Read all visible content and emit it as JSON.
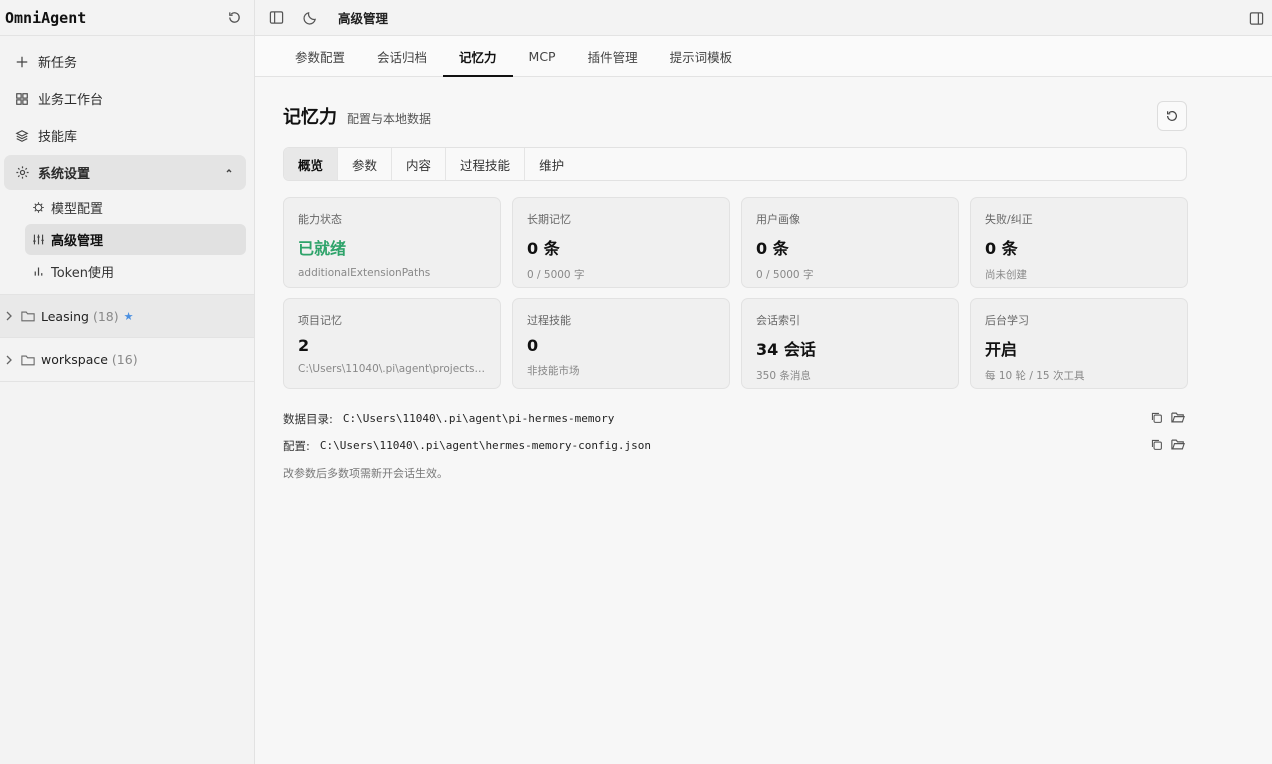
{
  "app": {
    "brand": "OmniAgent"
  },
  "sidebar": {
    "nav": [
      {
        "label": "新任务",
        "icon": "plus-icon"
      },
      {
        "label": "业务工作台",
        "icon": "grid-icon"
      },
      {
        "label": "技能库",
        "icon": "layers-icon"
      },
      {
        "label": "系统设置",
        "icon": "gear-icon"
      }
    ],
    "settings_children": [
      {
        "label": "模型配置",
        "icon": "chip-icon"
      },
      {
        "label": "高级管理",
        "icon": "sliders-icon"
      },
      {
        "label": "Token使用",
        "icon": "bar-chart-icon"
      }
    ],
    "folders": [
      {
        "name": "Leasing",
        "count": "(18)",
        "star": "★"
      },
      {
        "name": "workspace",
        "count": "(16)"
      }
    ]
  },
  "topbar": {
    "title": "高级管理"
  },
  "tabs": [
    "参数配置",
    "会话归档",
    "记忆力",
    "MCP",
    "插件管理",
    "提示词模板"
  ],
  "page": {
    "title": "记忆力",
    "subtitle": "配置与本地数据",
    "segments": [
      "概览",
      "参数",
      "内容",
      "过程技能",
      "维护"
    ],
    "cards": [
      {
        "label": "能力状态",
        "value": "已就绪",
        "note": "additionalExtensionPaths"
      },
      {
        "label": "长期记忆",
        "value": "0 条",
        "note": "0 / 5000 字"
      },
      {
        "label": "用户画像",
        "value": "0 条",
        "note": "0 / 5000 字"
      },
      {
        "label": "失败/纠正",
        "value": "0 条",
        "note": "尚未创建"
      },
      {
        "label": "项目记忆",
        "value": "2",
        "note": "C:\\Users\\11040\\.pi\\agent\\projects-m..."
      },
      {
        "label": "过程技能",
        "value": "0",
        "note": "非技能市场"
      },
      {
        "label": "会话索引",
        "value": "34 会话",
        "note": "350 条消息"
      },
      {
        "label": "后台学习",
        "value": "开启",
        "note": "每 10 轮 / 15 次工具"
      }
    ],
    "paths": [
      {
        "key": "数据目录:",
        "value": "C:\\Users\\11040\\.pi\\agent\\pi-hermes-memory"
      },
      {
        "key": "配置:",
        "value": "C:\\Users\\11040\\.pi\\agent\\hermes-memory-config.json"
      }
    ],
    "hint": "改参数后多数项需新开会话生效。"
  },
  "colors": {
    "ready": "#2ea36a",
    "star": "#4a8fe0"
  }
}
